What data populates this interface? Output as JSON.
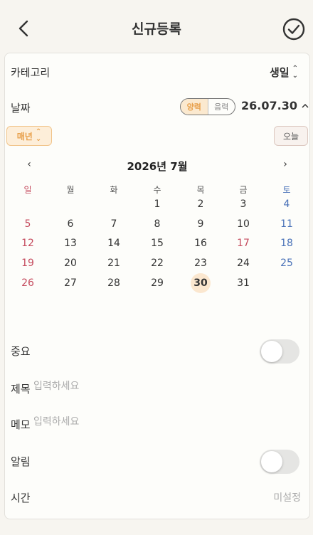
{
  "header": {
    "back_icon": "chevron-left-icon",
    "title": "신규등록",
    "confirm_icon": "check-circle-icon"
  },
  "category": {
    "label": "카테고리",
    "value": "생일"
  },
  "date": {
    "label": "날짜",
    "calendar_types": [
      {
        "label": "양력",
        "active": true
      },
      {
        "label": "음력",
        "active": false
      }
    ],
    "value": "26.07.30"
  },
  "repeat": {
    "label": "매년"
  },
  "today_button": "오늘",
  "calendar": {
    "prev": "‹",
    "next": "›",
    "title": "2026년 7월",
    "weekdays": [
      "일",
      "월",
      "화",
      "수",
      "목",
      "금",
      "토"
    ],
    "weeks": [
      [
        "",
        "",
        "",
        "1",
        "2",
        "3",
        "4"
      ],
      [
        "5",
        "6",
        "7",
        "8",
        "9",
        "10",
        "11"
      ],
      [
        "12",
        "13",
        "14",
        "15",
        "16",
        "17",
        "18"
      ],
      [
        "19",
        "20",
        "21",
        "22",
        "23",
        "24",
        "25"
      ],
      [
        "26",
        "27",
        "28",
        "29",
        "30",
        "31",
        ""
      ]
    ],
    "selected_day": "30",
    "holidays": [
      "17"
    ],
    "colors": {
      "sunday": "#c54b5e",
      "saturday": "#4a72b8",
      "selected_bg": "#fbe7cf",
      "accent": "#e8a04b"
    }
  },
  "important": {
    "label": "중요",
    "on": false
  },
  "title_field": {
    "label": "제목",
    "value": "",
    "placeholder": "입력하세요"
  },
  "memo_field": {
    "label": "메모",
    "value": "",
    "placeholder": "입력하세요"
  },
  "alarm": {
    "label": "알림",
    "on": false
  },
  "time": {
    "label": "시간",
    "value": "미설정"
  }
}
